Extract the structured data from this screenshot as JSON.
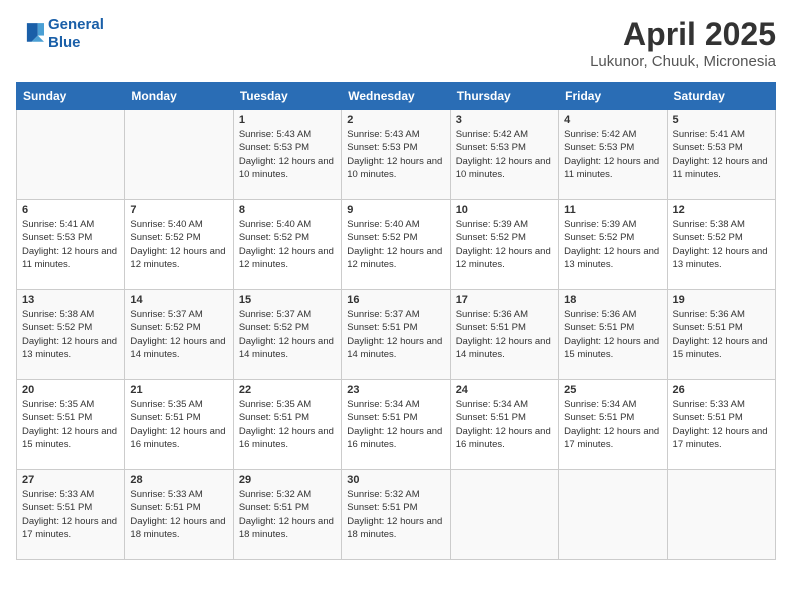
{
  "logo": {
    "line1": "General",
    "line2": "Blue"
  },
  "title": "April 2025",
  "subtitle": "Lukunor, Chuuk, Micronesia",
  "headers": [
    "Sunday",
    "Monday",
    "Tuesday",
    "Wednesday",
    "Thursday",
    "Friday",
    "Saturday"
  ],
  "weeks": [
    [
      {
        "day": "",
        "sunrise": "",
        "sunset": "",
        "daylight": ""
      },
      {
        "day": "",
        "sunrise": "",
        "sunset": "",
        "daylight": ""
      },
      {
        "day": "1",
        "sunrise": "Sunrise: 5:43 AM",
        "sunset": "Sunset: 5:53 PM",
        "daylight": "Daylight: 12 hours and 10 minutes."
      },
      {
        "day": "2",
        "sunrise": "Sunrise: 5:43 AM",
        "sunset": "Sunset: 5:53 PM",
        "daylight": "Daylight: 12 hours and 10 minutes."
      },
      {
        "day": "3",
        "sunrise": "Sunrise: 5:42 AM",
        "sunset": "Sunset: 5:53 PM",
        "daylight": "Daylight: 12 hours and 10 minutes."
      },
      {
        "day": "4",
        "sunrise": "Sunrise: 5:42 AM",
        "sunset": "Sunset: 5:53 PM",
        "daylight": "Daylight: 12 hours and 11 minutes."
      },
      {
        "day": "5",
        "sunrise": "Sunrise: 5:41 AM",
        "sunset": "Sunset: 5:53 PM",
        "daylight": "Daylight: 12 hours and 11 minutes."
      }
    ],
    [
      {
        "day": "6",
        "sunrise": "Sunrise: 5:41 AM",
        "sunset": "Sunset: 5:53 PM",
        "daylight": "Daylight: 12 hours and 11 minutes."
      },
      {
        "day": "7",
        "sunrise": "Sunrise: 5:40 AM",
        "sunset": "Sunset: 5:52 PM",
        "daylight": "Daylight: 12 hours and 12 minutes."
      },
      {
        "day": "8",
        "sunrise": "Sunrise: 5:40 AM",
        "sunset": "Sunset: 5:52 PM",
        "daylight": "Daylight: 12 hours and 12 minutes."
      },
      {
        "day": "9",
        "sunrise": "Sunrise: 5:40 AM",
        "sunset": "Sunset: 5:52 PM",
        "daylight": "Daylight: 12 hours and 12 minutes."
      },
      {
        "day": "10",
        "sunrise": "Sunrise: 5:39 AM",
        "sunset": "Sunset: 5:52 PM",
        "daylight": "Daylight: 12 hours and 12 minutes."
      },
      {
        "day": "11",
        "sunrise": "Sunrise: 5:39 AM",
        "sunset": "Sunset: 5:52 PM",
        "daylight": "Daylight: 12 hours and 13 minutes."
      },
      {
        "day": "12",
        "sunrise": "Sunrise: 5:38 AM",
        "sunset": "Sunset: 5:52 PM",
        "daylight": "Daylight: 12 hours and 13 minutes."
      }
    ],
    [
      {
        "day": "13",
        "sunrise": "Sunrise: 5:38 AM",
        "sunset": "Sunset: 5:52 PM",
        "daylight": "Daylight: 12 hours and 13 minutes."
      },
      {
        "day": "14",
        "sunrise": "Sunrise: 5:37 AM",
        "sunset": "Sunset: 5:52 PM",
        "daylight": "Daylight: 12 hours and 14 minutes."
      },
      {
        "day": "15",
        "sunrise": "Sunrise: 5:37 AM",
        "sunset": "Sunset: 5:52 PM",
        "daylight": "Daylight: 12 hours and 14 minutes."
      },
      {
        "day": "16",
        "sunrise": "Sunrise: 5:37 AM",
        "sunset": "Sunset: 5:51 PM",
        "daylight": "Daylight: 12 hours and 14 minutes."
      },
      {
        "day": "17",
        "sunrise": "Sunrise: 5:36 AM",
        "sunset": "Sunset: 5:51 PM",
        "daylight": "Daylight: 12 hours and 14 minutes."
      },
      {
        "day": "18",
        "sunrise": "Sunrise: 5:36 AM",
        "sunset": "Sunset: 5:51 PM",
        "daylight": "Daylight: 12 hours and 15 minutes."
      },
      {
        "day": "19",
        "sunrise": "Sunrise: 5:36 AM",
        "sunset": "Sunset: 5:51 PM",
        "daylight": "Daylight: 12 hours and 15 minutes."
      }
    ],
    [
      {
        "day": "20",
        "sunrise": "Sunrise: 5:35 AM",
        "sunset": "Sunset: 5:51 PM",
        "daylight": "Daylight: 12 hours and 15 minutes."
      },
      {
        "day": "21",
        "sunrise": "Sunrise: 5:35 AM",
        "sunset": "Sunset: 5:51 PM",
        "daylight": "Daylight: 12 hours and 16 minutes."
      },
      {
        "day": "22",
        "sunrise": "Sunrise: 5:35 AM",
        "sunset": "Sunset: 5:51 PM",
        "daylight": "Daylight: 12 hours and 16 minutes."
      },
      {
        "day": "23",
        "sunrise": "Sunrise: 5:34 AM",
        "sunset": "Sunset: 5:51 PM",
        "daylight": "Daylight: 12 hours and 16 minutes."
      },
      {
        "day": "24",
        "sunrise": "Sunrise: 5:34 AM",
        "sunset": "Sunset: 5:51 PM",
        "daylight": "Daylight: 12 hours and 16 minutes."
      },
      {
        "day": "25",
        "sunrise": "Sunrise: 5:34 AM",
        "sunset": "Sunset: 5:51 PM",
        "daylight": "Daylight: 12 hours and 17 minutes."
      },
      {
        "day": "26",
        "sunrise": "Sunrise: 5:33 AM",
        "sunset": "Sunset: 5:51 PM",
        "daylight": "Daylight: 12 hours and 17 minutes."
      }
    ],
    [
      {
        "day": "27",
        "sunrise": "Sunrise: 5:33 AM",
        "sunset": "Sunset: 5:51 PM",
        "daylight": "Daylight: 12 hours and 17 minutes."
      },
      {
        "day": "28",
        "sunrise": "Sunrise: 5:33 AM",
        "sunset": "Sunset: 5:51 PM",
        "daylight": "Daylight: 12 hours and 18 minutes."
      },
      {
        "day": "29",
        "sunrise": "Sunrise: 5:32 AM",
        "sunset": "Sunset: 5:51 PM",
        "daylight": "Daylight: 12 hours and 18 minutes."
      },
      {
        "day": "30",
        "sunrise": "Sunrise: 5:32 AM",
        "sunset": "Sunset: 5:51 PM",
        "daylight": "Daylight: 12 hours and 18 minutes."
      },
      {
        "day": "",
        "sunrise": "",
        "sunset": "",
        "daylight": ""
      },
      {
        "day": "",
        "sunrise": "",
        "sunset": "",
        "daylight": ""
      },
      {
        "day": "",
        "sunrise": "",
        "sunset": "",
        "daylight": ""
      }
    ]
  ]
}
